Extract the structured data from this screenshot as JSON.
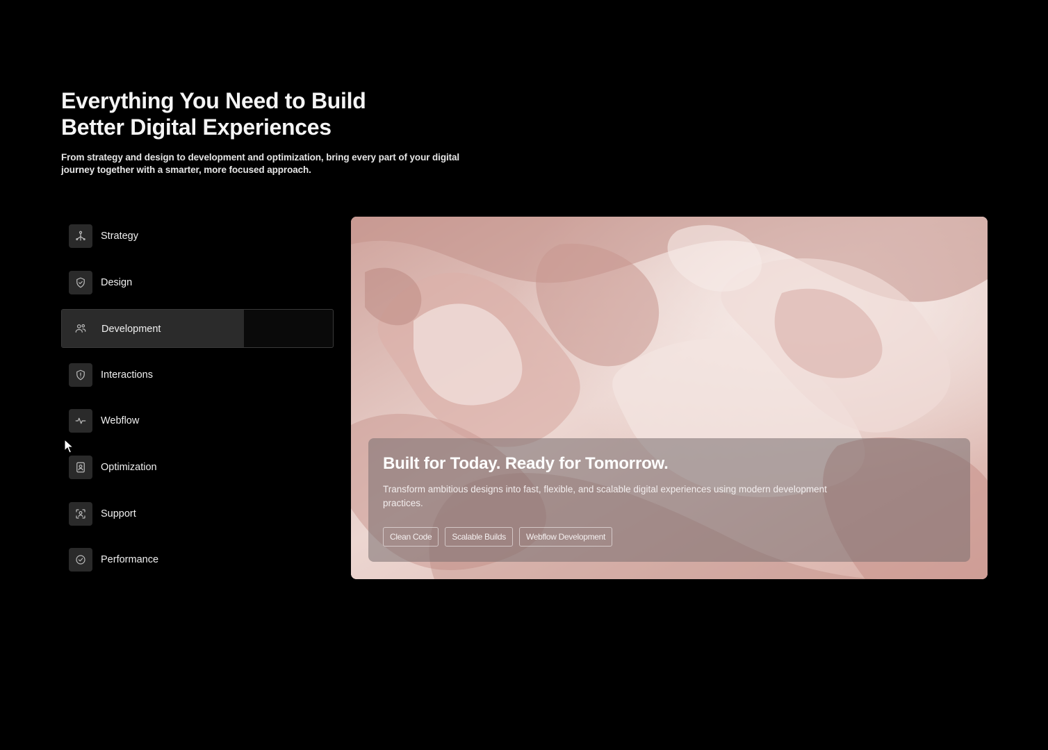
{
  "header": {
    "title_line1": "Everything You Need to Build",
    "title_line2": "Better Digital Experiences",
    "subtitle": "From strategy and design to development and optimization, bring every part of your digital journey together with a smarter, more focused approach."
  },
  "nav": {
    "items": [
      {
        "label": "Strategy",
        "icon": "strategy-icon"
      },
      {
        "label": "Design",
        "icon": "shield-check-icon"
      },
      {
        "label": "Development",
        "icon": "users-icon",
        "active": true
      },
      {
        "label": "Interactions",
        "icon": "shield-alert-icon"
      },
      {
        "label": "Webflow",
        "icon": "activity-icon"
      },
      {
        "label": "Optimization",
        "icon": "contact-book-icon"
      },
      {
        "label": "Support",
        "icon": "scan-face-icon"
      },
      {
        "label": "Performance",
        "icon": "check-circle-icon"
      }
    ],
    "active_index": 2
  },
  "card": {
    "title": "Built for Today. Ready for Tomorrow.",
    "description": "Transform ambitious designs into fast, flexible, and scalable digital experiences using modern development practices.",
    "tags": [
      "Clean Code",
      "Scalable Builds",
      "Webflow Development"
    ]
  },
  "colors": {
    "background": "#000000",
    "nav_active": "#2b2b2b",
    "icon_box": "#2a2a2a",
    "marble_base": "#d9b5ae"
  }
}
